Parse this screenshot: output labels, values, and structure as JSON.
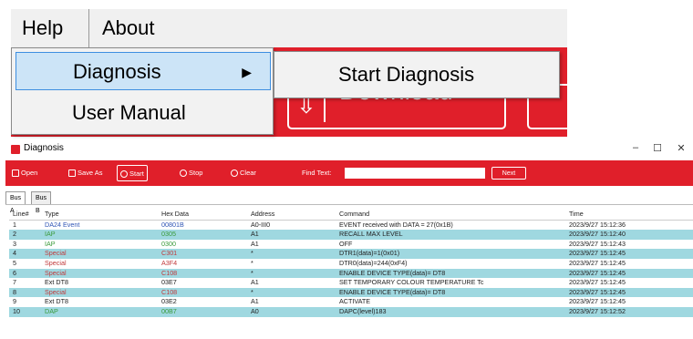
{
  "menubar": {
    "help": "Help",
    "about": "About"
  },
  "help_menu": {
    "items": [
      "Diagnosis",
      "User Manual"
    ],
    "submenu_arrow": "▶"
  },
  "diagnosis_submenu": {
    "items": [
      "Start Diagnosis"
    ]
  },
  "background": {
    "download_label": "Download",
    "accent_color": "#e01f2a"
  },
  "window": {
    "title": "Diagnosis",
    "controls": {
      "minimize": "–",
      "maximize": "☐",
      "close": "✕"
    }
  },
  "toolbar": {
    "open": "Open",
    "save_as": "Save As",
    "start": "Start",
    "stop": "Stop",
    "clear": "Clear",
    "find_label": "Find Text:",
    "find_value": "",
    "next": "Next"
  },
  "tabs": [
    "Bus A",
    "Bus B"
  ],
  "table": {
    "columns": [
      "Line#",
      "Type",
      "Hex Data",
      "Address",
      "Command",
      "Time"
    ],
    "rows": [
      {
        "line": "1",
        "type": "DA24 Event",
        "type_color": "blue",
        "hex": "00801B",
        "address": "A0-III0",
        "command": "EVENT received with DATA = 27(0x1B)",
        "time": "2023/9/27 15:12:36"
      },
      {
        "line": "2",
        "type": "IAP",
        "type_color": "green",
        "hex": "0305",
        "address": "A1",
        "command": "RECALL MAX LEVEL",
        "time": "2023/9/27 15:12:40"
      },
      {
        "line": "3",
        "type": "IAP",
        "type_color": "green",
        "hex": "0300",
        "address": "A1",
        "command": "OFF",
        "time": "2023/9/27 15:12:43"
      },
      {
        "line": "4",
        "type": "Special",
        "type_color": "red",
        "hex": "C301",
        "address": "*",
        "command": "DTR1(data)=1(0x01)",
        "time": "2023/9/27 15:12:45"
      },
      {
        "line": "5",
        "type": "Special",
        "type_color": "red",
        "hex": "A3F4",
        "address": "*",
        "command": "DTR0(data)=244(0xF4)",
        "time": "2023/9/27 15:12:45"
      },
      {
        "line": "6",
        "type": "Special",
        "type_color": "red",
        "hex": "C108",
        "address": "*",
        "command": "ENABLE DEVICE TYPE(data)= DT8",
        "time": "2023/9/27 15:12:45"
      },
      {
        "line": "7",
        "type": "Ext DT8",
        "type_color": "black",
        "hex": "03E7",
        "address": "A1",
        "command": "SET TEMPORARY COLOUR TEMPERATURE Tc",
        "time": "2023/9/27 15:12:45"
      },
      {
        "line": "8",
        "type": "Special",
        "type_color": "red",
        "hex": "C108",
        "address": "*",
        "command": "ENABLE DEVICE TYPE(data)= DT8",
        "time": "2023/9/27 15:12:45"
      },
      {
        "line": "9",
        "type": "Ext DT8",
        "type_color": "black",
        "hex": "03E2",
        "address": "A1",
        "command": "ACTIVATE",
        "time": "2023/9/27 15:12:45"
      },
      {
        "line": "10",
        "type": "DAP",
        "type_color": "green",
        "hex": "00B7",
        "address": "A0",
        "command": "DAPC(level)183",
        "time": "2023/9/27 15:12:52"
      }
    ]
  }
}
